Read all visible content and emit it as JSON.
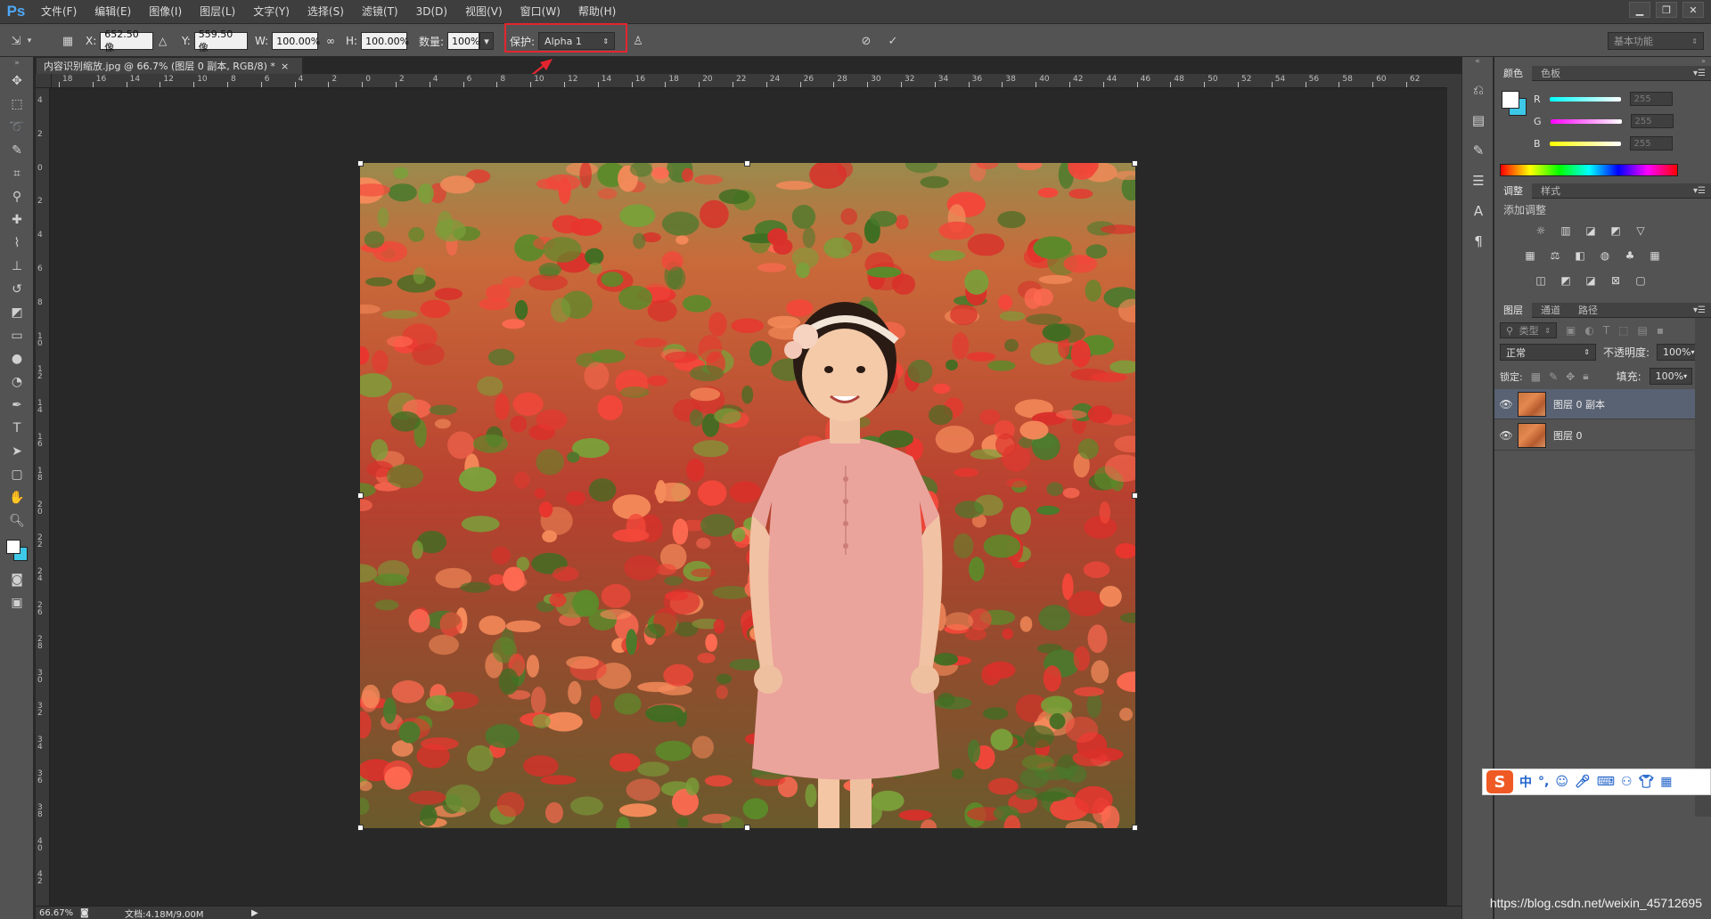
{
  "app": {
    "logo": "Ps"
  },
  "menu": [
    "文件(F)",
    "编辑(E)",
    "图像(I)",
    "图层(L)",
    "文字(Y)",
    "选择(S)",
    "滤镜(T)",
    "3D(D)",
    "视图(V)",
    "窗口(W)",
    "帮助(H)"
  ],
  "options": {
    "x_label": "X:",
    "x_value": "652.50 像",
    "y_label": "Y:",
    "y_value": "559.50 像",
    "w_label": "W:",
    "w_value": "100.00%",
    "h_label": "H:",
    "h_value": "100.00%",
    "amount_label": "数量:",
    "amount_value": "100%",
    "protect_label": "保护:",
    "protect_value": "Alpha 1",
    "workspace": "基本功能"
  },
  "document": {
    "tab_title": "内容识别缩放.jpg @ 66.7% (图层 0 副本, RGB/8) *",
    "close": "×",
    "zoom": "66.67%",
    "doc_size": "文档:4.18M/9.00M"
  },
  "ruler": {
    "h_labels": [
      "18",
      "16",
      "14",
      "12",
      "10",
      "8",
      "6",
      "4",
      "2",
      "0",
      "2",
      "4",
      "6",
      "8",
      "10",
      "12",
      "14",
      "16",
      "18",
      "20",
      "22",
      "24",
      "26",
      "28",
      "30",
      "32",
      "34",
      "36",
      "38",
      "40",
      "42",
      "44",
      "46",
      "48",
      "50",
      "52",
      "54",
      "56",
      "58",
      "60",
      "62"
    ],
    "v_labels": [
      "4",
      "2",
      "0",
      "2",
      "4",
      "6",
      "8",
      "1 0",
      "1 2",
      "1 4",
      "1 6",
      "1 8",
      "2 0",
      "2 2",
      "2 4",
      "2 6",
      "2 8",
      "3 0",
      "3 2",
      "3 4",
      "3 6",
      "3 8",
      "4 0",
      "4 2"
    ]
  },
  "color_panel": {
    "tabs": [
      "颜色",
      "色板"
    ],
    "r_label": "R",
    "r_value": "255",
    "g_label": "G",
    "g_value": "255",
    "b_label": "B",
    "b_value": "255",
    "fg_color": "#ffffff",
    "bg_color": "#3ec8e8"
  },
  "adjust_panel": {
    "tabs": [
      "调整",
      "样式"
    ],
    "title": "添加调整"
  },
  "layers_panel": {
    "tabs": [
      "图层",
      "通道",
      "路径"
    ],
    "filter": "类型",
    "blend_mode": "正常",
    "opacity_label": "不透明度:",
    "opacity_value": "100%",
    "lock_label": "锁定:",
    "fill_label": "填充:",
    "fill_value": "100%",
    "layers": [
      {
        "name": "图层 0 副本",
        "selected": true
      },
      {
        "name": "图层 0",
        "selected": false
      }
    ]
  },
  "ime": {
    "logo": "S",
    "mode": "中",
    "punct": "°,",
    "emoji": "☺"
  },
  "watermark": "https://blog.csdn.net/weixin_45712695"
}
